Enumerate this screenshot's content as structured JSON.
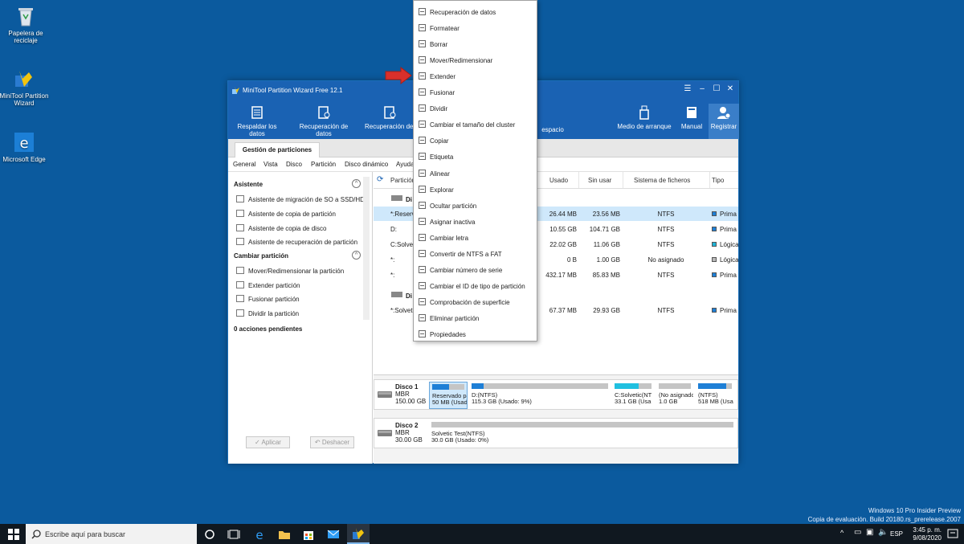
{
  "desktop": {
    "icons": [
      {
        "label": "Papelera de reciclaje"
      },
      {
        "label": "MiniTool Partition Wizard"
      },
      {
        "label": "Microsoft Edge"
      }
    ],
    "watermark": {
      "line1": "Windows 10 Pro Insider Preview",
      "line2": "Copia de evaluación. Build 20180.rs_prerelease.2007"
    }
  },
  "window": {
    "title": "MiniTool Partition Wizard Free 12.1",
    "toolbar": [
      {
        "label": "Respaldar los datos"
      },
      {
        "label": "Recuperación de datos"
      },
      {
        "label": "Recuperación de p"
      },
      {
        "label": "espacio"
      },
      {
        "label": "Medio de arranque"
      },
      {
        "label": "Manual"
      },
      {
        "label": "Registrar"
      }
    ],
    "tab": "Gestión de particiones",
    "menu": [
      "General",
      "Vista",
      "Disco",
      "Partición",
      "Disco dinámico",
      "Ayuda"
    ]
  },
  "left_panel": {
    "section1": {
      "title": "Asistente",
      "items": [
        "Asistente de migración de SO a SSD/HD",
        "Asistente de copia de partición",
        "Asistente de copia de disco",
        "Asistente de recuperación de partición"
      ]
    },
    "section2": {
      "title": "Cambiar partición",
      "items": [
        "Mover/Redimensionar la partición",
        "Extender partición",
        "Fusionar partición",
        "Dividir la partición"
      ]
    },
    "pending": "0 acciones pendientes",
    "apply": "✓ Aplicar",
    "undo": "↶ Deshacer"
  },
  "table": {
    "headers": {
      "partition": "Partición",
      "used": "Usado",
      "unused": "Sin usar",
      "fs": "Sistema de ficheros",
      "type": "Tipo"
    },
    "disk1_label": "Di",
    "disk2_label": "Di",
    "rows": [
      {
        "name": "*:Reserva",
        "capacity": "",
        "used": "26.44 MB",
        "unused": "23.56 MB",
        "fs": "NTFS",
        "type": "Prima",
        "selected": true,
        "color": "#1e7fd6"
      },
      {
        "name": "D:",
        "capacity": "",
        "used": "10.55 GB",
        "unused": "104.71 GB",
        "fs": "NTFS",
        "type": "Prima",
        "selected": false,
        "color": "#1e7fd6"
      },
      {
        "name": "C:Solveti",
        "capacity": "",
        "used": "22.02 GB",
        "unused": "11.06 GB",
        "fs": "NTFS",
        "type": "Lógica",
        "selected": false,
        "color": "#20b3d6"
      },
      {
        "name": "*:",
        "capacity": "",
        "used": "0 B",
        "unused": "1.00 GB",
        "fs": "No asignado",
        "type": "Lógica",
        "selected": false,
        "color": "#b8b8b8"
      },
      {
        "name": "*:",
        "capacity": "432.17 MB",
        "used": "",
        "unused": "85.83 MB",
        "fs": "NTFS",
        "type": "Prima",
        "selected": false,
        "color": "#1e7fd6"
      },
      {
        "name": "*:Solveti",
        "capacity": "",
        "used": "67.37 MB",
        "unused": "29.93 GB",
        "fs": "NTFS",
        "type": "Prima",
        "selected": false,
        "color": "#1e7fd6"
      }
    ]
  },
  "disk_map": {
    "disk1": {
      "name": "Disco 1",
      "scheme": "MBR",
      "size": "150.00 GB",
      "parts": [
        {
          "l1": "Reservado pa",
          "l2": "50 MB (Usado:",
          "fill": 0.53
        },
        {
          "l1": "D:(NTFS)",
          "l2": "115.3 GB (Usado: 9%)",
          "fill": 0.09
        },
        {
          "l1": "C:Solvetic(NT",
          "l2": "33.1 GB (Usa",
          "fill": 0.66
        },
        {
          "l1": "(No asignado",
          "l2": "1.0 GB",
          "fill": 0
        },
        {
          "l1": "(NTFS)",
          "l2": "518 MB (Usa",
          "fill": 0.83
        }
      ]
    },
    "disk2": {
      "name": "Disco 2",
      "scheme": "MBR",
      "size": "30.00 GB",
      "parts": [
        {
          "l1": "Solvetic Test(NTFS)",
          "l2": "30.0 GB (Usado: 0%)",
          "fill": 0
        }
      ]
    }
  },
  "context_menu": [
    "Recuperación de datos",
    "Formatear",
    "Borrar",
    "Mover/Redimensionar",
    "Extender",
    "Fusionar",
    "Dividir",
    "Cambiar el tamaño del cluster",
    "Copiar",
    "Etiqueta",
    "Alinear",
    "Explorar",
    "Ocultar partición",
    "Asignar inactiva",
    "Cambiar letra",
    "Convertir de NTFS a FAT",
    "Cambiar número de serie",
    "Cambiar el ID de tipo de partición",
    "Comprobación de superficie",
    "Eliminar partición",
    "Propiedades"
  ],
  "taskbar": {
    "search_placeholder": "Escribe aquí para buscar",
    "lang": "ESP",
    "time": "3:45 p. m.",
    "date": "9/08/2020"
  },
  "colors": {
    "accent": "#1a62b3",
    "desktop": "#0b5a9e",
    "arrow": "#d9302b"
  }
}
